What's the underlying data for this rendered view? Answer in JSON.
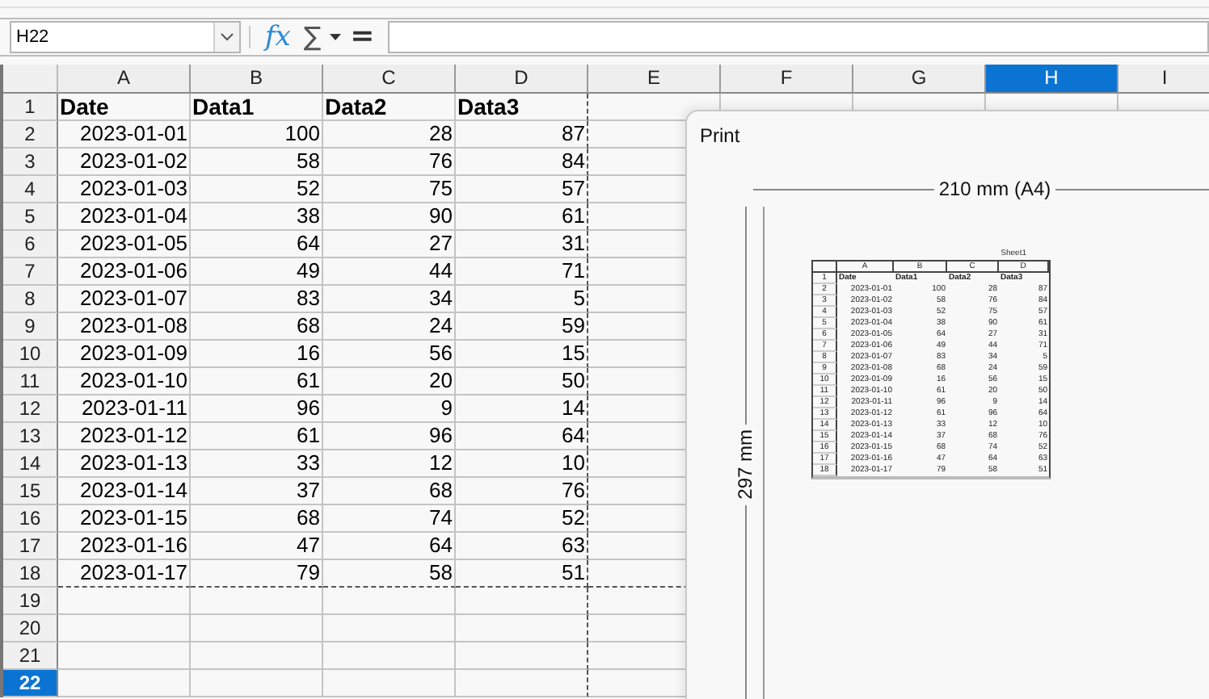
{
  "formula_bar": {
    "name_box": "H22",
    "function_wizard": "fx",
    "sum": "∑",
    "equals": "="
  },
  "columns": [
    {
      "label": "A",
      "selected": false
    },
    {
      "label": "B",
      "selected": false
    },
    {
      "label": "C",
      "selected": false
    },
    {
      "label": "D",
      "selected": false
    },
    {
      "label": "E",
      "selected": false
    },
    {
      "label": "F",
      "selected": false
    },
    {
      "label": "G",
      "selected": false
    },
    {
      "label": "H",
      "selected": true
    },
    {
      "label": "I",
      "selected": false
    }
  ],
  "rows": [
    {
      "number": "1",
      "selected": false,
      "kind": "header",
      "cells": [
        "Date",
        "Data1",
        "Data2",
        "Data3"
      ]
    },
    {
      "number": "2",
      "selected": false,
      "kind": "data",
      "cells": [
        "2023-01-01",
        "100",
        "28",
        "87"
      ]
    },
    {
      "number": "3",
      "selected": false,
      "kind": "data",
      "cells": [
        "2023-01-02",
        "58",
        "76",
        "84"
      ]
    },
    {
      "number": "4",
      "selected": false,
      "kind": "data",
      "cells": [
        "2023-01-03",
        "52",
        "75",
        "57"
      ]
    },
    {
      "number": "5",
      "selected": false,
      "kind": "data",
      "cells": [
        "2023-01-04",
        "38",
        "90",
        "61"
      ]
    },
    {
      "number": "6",
      "selected": false,
      "kind": "data",
      "cells": [
        "2023-01-05",
        "64",
        "27",
        "31"
      ]
    },
    {
      "number": "7",
      "selected": false,
      "kind": "data",
      "cells": [
        "2023-01-06",
        "49",
        "44",
        "71"
      ]
    },
    {
      "number": "8",
      "selected": false,
      "kind": "data",
      "cells": [
        "2023-01-07",
        "83",
        "34",
        "5"
      ]
    },
    {
      "number": "9",
      "selected": false,
      "kind": "data",
      "cells": [
        "2023-01-08",
        "68",
        "24",
        "59"
      ]
    },
    {
      "number": "10",
      "selected": false,
      "kind": "data",
      "cells": [
        "2023-01-09",
        "16",
        "56",
        "15"
      ]
    },
    {
      "number": "11",
      "selected": false,
      "kind": "data",
      "cells": [
        "2023-01-10",
        "61",
        "20",
        "50"
      ]
    },
    {
      "number": "12",
      "selected": false,
      "kind": "data",
      "cells": [
        "2023-01-11",
        "96",
        "9",
        "14"
      ]
    },
    {
      "number": "13",
      "selected": false,
      "kind": "data",
      "cells": [
        "2023-01-12",
        "61",
        "96",
        "64"
      ]
    },
    {
      "number": "14",
      "selected": false,
      "kind": "data",
      "cells": [
        "2023-01-13",
        "33",
        "12",
        "10"
      ]
    },
    {
      "number": "15",
      "selected": false,
      "kind": "data",
      "cells": [
        "2023-01-14",
        "37",
        "68",
        "76"
      ]
    },
    {
      "number": "16",
      "selected": false,
      "kind": "data",
      "cells": [
        "2023-01-15",
        "68",
        "74",
        "52"
      ]
    },
    {
      "number": "17",
      "selected": false,
      "kind": "data",
      "cells": [
        "2023-01-16",
        "47",
        "64",
        "63"
      ]
    },
    {
      "number": "18",
      "selected": false,
      "kind": "data",
      "cells": [
        "2023-01-17",
        "79",
        "58",
        "51"
      ]
    },
    {
      "number": "19",
      "selected": false,
      "cells": []
    },
    {
      "number": "20",
      "selected": false,
      "cells": []
    },
    {
      "number": "21",
      "selected": false,
      "cells": []
    },
    {
      "number": "22",
      "selected": true,
      "cells": []
    }
  ],
  "print_dialog": {
    "title": "Print",
    "width_label": "210 mm (A4)",
    "height_label": "297 mm",
    "preview": {
      "sheet_name": "Sheet1",
      "columns": [
        "A",
        "B",
        "C",
        "D"
      ],
      "rows": [
        {
          "number": "1",
          "kind": "header",
          "cells": [
            "Date",
            "Data1",
            "Data2",
            "Data3"
          ]
        },
        {
          "number": "2",
          "kind": "data",
          "cells": [
            "2023-01-01",
            "100",
            "28",
            "87"
          ]
        },
        {
          "number": "3",
          "kind": "data",
          "cells": [
            "2023-01-02",
            "58",
            "76",
            "84"
          ]
        },
        {
          "number": "4",
          "kind": "data",
          "cells": [
            "2023-01-03",
            "52",
            "75",
            "57"
          ]
        },
        {
          "number": "5",
          "kind": "data",
          "cells": [
            "2023-01-04",
            "38",
            "90",
            "61"
          ]
        },
        {
          "number": "6",
          "kind": "data",
          "cells": [
            "2023-01-05",
            "64",
            "27",
            "31"
          ]
        },
        {
          "number": "7",
          "kind": "data",
          "cells": [
            "2023-01-06",
            "49",
            "44",
            "71"
          ]
        },
        {
          "number": "8",
          "kind": "data",
          "cells": [
            "2023-01-07",
            "83",
            "34",
            "5"
          ]
        },
        {
          "number": "9",
          "kind": "data",
          "cells": [
            "2023-01-08",
            "68",
            "24",
            "59"
          ]
        },
        {
          "number": "10",
          "kind": "data",
          "cells": [
            "2023-01-09",
            "16",
            "56",
            "15"
          ]
        },
        {
          "number": "11",
          "kind": "data",
          "cells": [
            "2023-01-10",
            "61",
            "20",
            "50"
          ]
        },
        {
          "number": "12",
          "kind": "data",
          "cells": [
            "2023-01-11",
            "96",
            "9",
            "14"
          ]
        },
        {
          "number": "13",
          "kind": "data",
          "cells": [
            "2023-01-12",
            "61",
            "96",
            "64"
          ]
        },
        {
          "number": "14",
          "kind": "data",
          "cells": [
            "2023-01-13",
            "33",
            "12",
            "10"
          ]
        },
        {
          "number": "15",
          "kind": "data",
          "cells": [
            "2023-01-14",
            "37",
            "68",
            "76"
          ]
        },
        {
          "number": "16",
          "kind": "data",
          "cells": [
            "2023-01-15",
            "68",
            "74",
            "52"
          ]
        },
        {
          "number": "17",
          "kind": "data",
          "cells": [
            "2023-01-16",
            "47",
            "64",
            "63"
          ]
        },
        {
          "number": "18",
          "kind": "data",
          "cells": [
            "2023-01-17",
            "79",
            "58",
            "51"
          ]
        }
      ]
    }
  }
}
